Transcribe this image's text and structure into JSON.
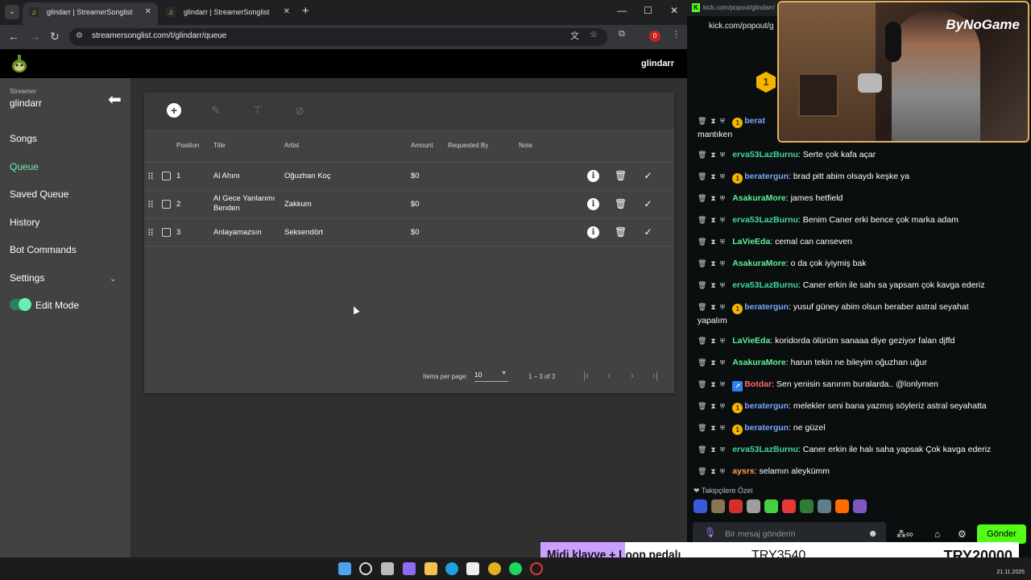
{
  "browser": {
    "tabs": [
      {
        "label": "glindarr | StreamerSonglist",
        "active": true
      },
      {
        "label": "glindarr | StreamerSonglist",
        "active": false
      }
    ],
    "url": "streamersonglist.com/t/glindarr/queue",
    "ext_badge": "0"
  },
  "app": {
    "user": "glindarr",
    "sidebar": {
      "caption": "Streamer",
      "streamer": "glindarr",
      "items": [
        {
          "label": "Songs"
        },
        {
          "label": "Queue",
          "active": true
        },
        {
          "label": "Saved Queue"
        },
        {
          "label": "History"
        },
        {
          "label": "Bot Commands"
        },
        {
          "label": "Settings"
        }
      ],
      "edit_mode_label": "Edit Mode",
      "edit_mode_on": true
    },
    "table": {
      "headers": {
        "position": "Position",
        "title": "Title",
        "artist": "Artist",
        "amount": "Amount",
        "requested_by": "Requested By",
        "note": "Note"
      },
      "rows": [
        {
          "position": "1",
          "title": "Al Ahını",
          "artist": "Oğuzhan Koç",
          "amount": "$0"
        },
        {
          "position": "2",
          "title": "Al Gece Yanlarımı Benden",
          "artist": "Zakkum",
          "amount": "$0"
        },
        {
          "position": "3",
          "title": "Anlayamazsın",
          "artist": "Seksendört",
          "amount": "$0"
        }
      ],
      "pagination": {
        "items_per_page_label": "Items per page:",
        "items_per_page": "10",
        "range": "1 – 3 of 3"
      }
    }
  },
  "chat": {
    "popout_url_1": "kick.com/popout/glindarr/",
    "popout_url_2": "kick.com/popout/g",
    "gift_count": "1",
    "messages": [
      {
        "badge": "1",
        "nick": "berat",
        "text": "",
        "color": "#7aa7ff",
        "cont": "mantıken"
      },
      {
        "badge": "",
        "nick": "erva53LazBurnu",
        "text": ": Serte çok kafa açar",
        "color": "#3fd8a5"
      },
      {
        "badge": "1",
        "nick": "beratergun",
        "text": ": brad pitt abim olsaydı keşke ya",
        "color": "#7aa7ff"
      },
      {
        "badge": "",
        "nick": "AsakuraMore",
        "text": ": james hetfield",
        "color": "#5cf29a"
      },
      {
        "badge": "",
        "nick": "erva53LazBurnu",
        "text": ": Benim Caner erki bence çok marka adam",
        "color": "#3fd8a5"
      },
      {
        "badge": "",
        "nick": "LaVieEda",
        "text": ": cemal can canseven",
        "color": "#5cf29a"
      },
      {
        "badge": "",
        "nick": "AsakuraMore",
        "text": ": o da çok iyiymiş bak",
        "color": "#5cf29a"
      },
      {
        "badge": "",
        "nick": "erva53LazBurnu",
        "text": ": Caner erkin ile sahı sa yapsam çok kavga ederiz",
        "color": "#3fd8a5"
      },
      {
        "badge": "1",
        "nick": "beratergun",
        "text": ": yusuf güney abim olsun beraber astral seyahat",
        "color": "#7aa7ff",
        "cont": "yapalım"
      },
      {
        "badge": "",
        "nick": "LaVieEda",
        "text": ": koridorda ölürüm sanaaa diye geziyor falan djffd",
        "color": "#5cf29a"
      },
      {
        "badge": "",
        "nick": "AsakuraMore",
        "text": ": harun tekin ne bileyim oğuzhan uğur",
        "color": "#5cf29a"
      },
      {
        "badge": "bot",
        "nick": "Botdar",
        "text": ": Sen yenisin sanırım buralarda.. @lonlymen",
        "color": "#ff6b6b"
      },
      {
        "badge": "1",
        "nick": "beratergun",
        "text": ": melekler seni bana yazmış söyleriz astral seyahatta",
        "color": "#7aa7ff"
      },
      {
        "badge": "1",
        "nick": "beratergun",
        "text": ": ne güzel",
        "color": "#7aa7ff"
      },
      {
        "badge": "",
        "nick": "erva53LazBurnu",
        "text": ": Caner erkin ile halı saha yapsak Çok kavga ederiz",
        "color": "#3fd8a5"
      },
      {
        "badge": "",
        "nick": "aysrs",
        "text": ": selamın aleykümm",
        "color": "#ff9d4d"
      }
    ],
    "follower_label": "Takipçilere Özel",
    "input_placeholder": "Bir mesaj gönderin",
    "send_label": "Gönder"
  },
  "overlay": {
    "brand": "ByNoGame",
    "banner_left": "Midi klavye + Loop pedalı",
    "banner_mid": "TRY3540",
    "banner_right": "TRY20000"
  },
  "taskbar": {
    "date": "21.11.2025"
  },
  "colors": {
    "accent_green": "#69f0ae",
    "kick_green": "#53fc18",
    "panel": "#424242"
  }
}
